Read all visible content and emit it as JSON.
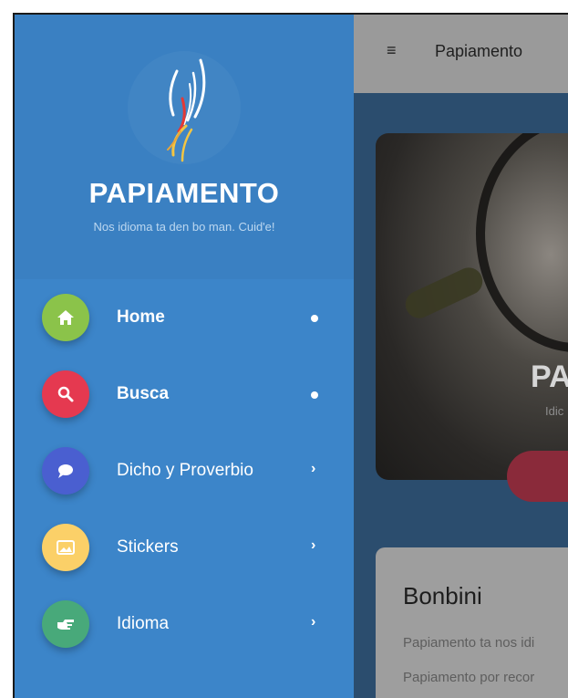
{
  "app_bar": {
    "menu_icon": "hamburger-menu-icon",
    "title": "Papiamento"
  },
  "hero": {
    "title": "PA",
    "subtitle": "Idic"
  },
  "card": {
    "title": "Bonbini",
    "line1": "Papiamento ta nos idi",
    "line2": "Papiamento por recor"
  },
  "drawer": {
    "brand": "PAPIAMENTO",
    "tagline": "Nos idioma ta den bo man. Cuid'e!",
    "items": [
      {
        "label": "Home",
        "icon": "home-icon",
        "color": "#8bc34a",
        "indicator": "dot"
      },
      {
        "label": "Busca",
        "icon": "search-icon",
        "color": "#e53950",
        "indicator": "dot"
      },
      {
        "label": "Dicho y Proverbio",
        "icon": "speech-bubble-icon",
        "color": "#4a5fd0",
        "indicator": "chevron"
      },
      {
        "label": "Stickers",
        "icon": "image-icon",
        "color": "#fbd068",
        "indicator": "chevron"
      },
      {
        "label": "Idioma",
        "icon": "pointing-hand-icon",
        "color": "#48a97a",
        "indicator": "chevron"
      }
    ],
    "chevron_glyph": "›"
  },
  "colors": {
    "drawer_bg": "#3c85c9",
    "scrim": "#2b4d6e"
  }
}
